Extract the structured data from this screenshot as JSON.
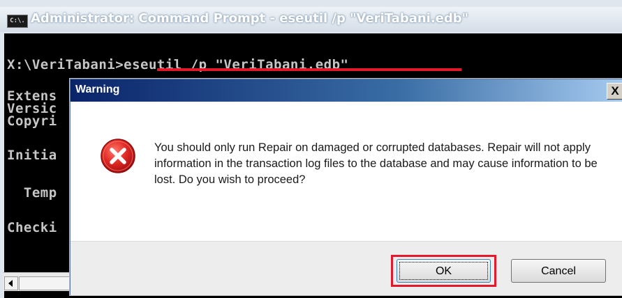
{
  "console": {
    "icon_text": "C:\\.",
    "title": "Administrator: Command Prompt - eseutil  /p \"VeriTabani.edb\"",
    "lines": [
      "X:\\VeriTabani>eseutil /p \"VeriTabani.edb\"",
      "",
      "Extens",
      "Versic",
      "Copyri",
      "",
      "Initia",
      "",
      "  Temp",
      "",
      "Checki"
    ]
  },
  "dialog": {
    "title": "Warning",
    "close_label": "X",
    "icon": "error-icon",
    "message": "You should only run Repair on damaged or corrupted databases. Repair will not apply information in the transaction log files to the database and may cause information to be lost. Do you wish to proceed?",
    "ok_label": "OK",
    "cancel_label": "Cancel"
  },
  "colors": {
    "highlight": "#e3182a",
    "console_bg": "#000000",
    "console_text": "#c6c6c6",
    "dialog_title_start": "#0a246a",
    "dialog_title_end": "#a6caf0",
    "error_red": "#d9222a"
  }
}
